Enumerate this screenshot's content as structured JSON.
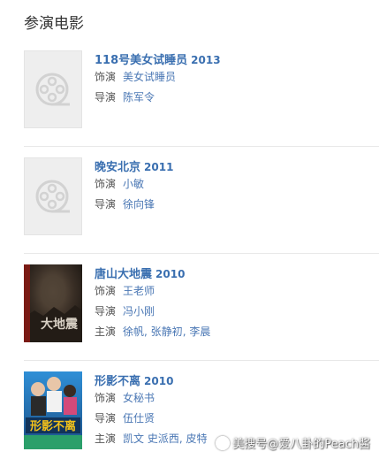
{
  "section": {
    "title": "参演电影"
  },
  "films": [
    {
      "title": "118号美女试睡员",
      "year": "2013",
      "poster": "placeholder",
      "rows": [
        {
          "label": "饰演",
          "values": [
            "美女试睡员"
          ]
        },
        {
          "label": "导演",
          "values": [
            "陈军令"
          ]
        }
      ]
    },
    {
      "title": "晚安北京",
      "year": "2011",
      "poster": "placeholder",
      "rows": [
        {
          "label": "饰演",
          "values": [
            "小敏"
          ]
        },
        {
          "label": "导演",
          "values": [
            "徐向锋"
          ]
        }
      ]
    },
    {
      "title": "唐山大地震",
      "year": "2010",
      "poster": "image-dark",
      "rows": [
        {
          "label": "饰演",
          "values": [
            "王老师"
          ]
        },
        {
          "label": "导演",
          "values": [
            "冯小刚"
          ]
        },
        {
          "label": "主演",
          "values": [
            "徐帆",
            "张静初",
            "李晨"
          ]
        }
      ]
    },
    {
      "title": "形影不离",
      "year": "2010",
      "poster": "image-blue",
      "rows": [
        {
          "label": "饰演",
          "values": [
            "女秘书"
          ]
        },
        {
          "label": "导演",
          "values": [
            "伍仕贤"
          ]
        },
        {
          "label": "主演",
          "values": [
            "凯文",
            "史派西",
            "皮特"
          ]
        }
      ]
    }
  ],
  "watermark": {
    "text": "美搜号@爱八卦的Peach酱",
    "icon": "logo-icon"
  },
  "colors": {
    "link": "#3a6fb0",
    "divider": "#e8e8e8",
    "placeholder_bg": "#eeeeee"
  }
}
